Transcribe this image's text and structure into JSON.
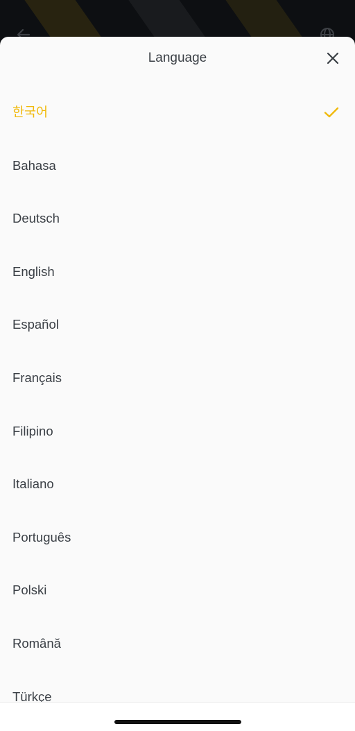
{
  "background": {
    "back_icon": "arrow-left-icon",
    "globe_icon": "globe-icon"
  },
  "sheet": {
    "title": "Language",
    "close_icon": "close-icon"
  },
  "languages": [
    {
      "label": "한국어",
      "selected": true
    },
    {
      "label": "Bahasa",
      "selected": false
    },
    {
      "label": "Deutsch",
      "selected": false
    },
    {
      "label": "English",
      "selected": false
    },
    {
      "label": "Español",
      "selected": false
    },
    {
      "label": "Français",
      "selected": false
    },
    {
      "label": "Filipino",
      "selected": false
    },
    {
      "label": "Italiano",
      "selected": false
    },
    {
      "label": "Português",
      "selected": false
    },
    {
      "label": "Polski",
      "selected": false
    },
    {
      "label": "Română",
      "selected": false
    },
    {
      "label": "Türkçe",
      "selected": false
    }
  ],
  "colors": {
    "accent": "#f0b90b",
    "text": "#3a3f45",
    "sheet_background": "#fafafa"
  }
}
